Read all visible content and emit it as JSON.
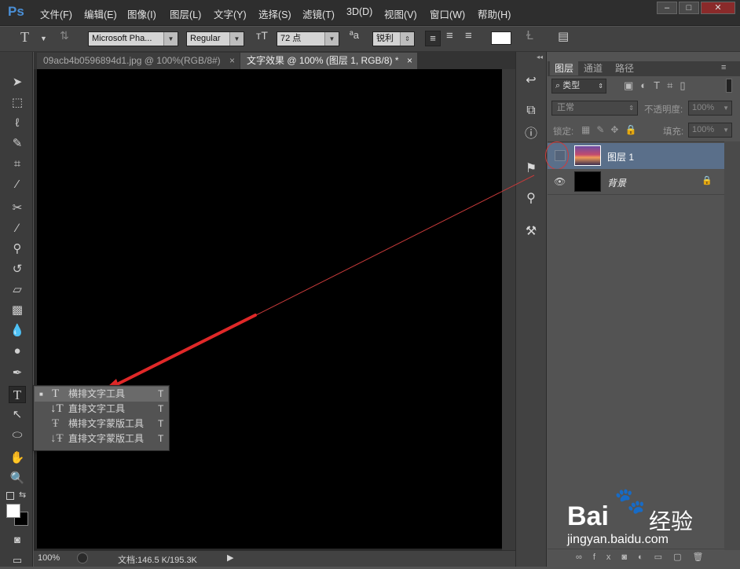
{
  "menubar": {
    "logo": "Ps",
    "items": [
      "文件(F)",
      "编辑(E)",
      "图像(I)",
      "图层(L)",
      "文字(Y)",
      "选择(S)",
      "滤镜(T)",
      "3D(D)",
      "视图(V)",
      "窗口(W)",
      "帮助(H)"
    ],
    "window_min": "–",
    "window_max": "□",
    "window_close": "✕"
  },
  "options": {
    "tool_glyph": "T",
    "font_family": "Microsoft Pha...",
    "font_style": "Regular",
    "size": "72 点",
    "antialias": "锐利",
    "color": "#ffffff"
  },
  "tabs": [
    {
      "label": "09acb4b0596894d1.jpg @ 100%(RGB/8#)",
      "close": "×"
    },
    {
      "label": "文字效果 @ 100% (图层 1, RGB/8) *",
      "close": "×"
    }
  ],
  "status": {
    "zoom": "100%",
    "doc": "文档:146.5 K/195.3K"
  },
  "flyout": [
    {
      "label": "横排文字工具",
      "key": "T",
      "icon": "horizontal-type-icon",
      "selected": true
    },
    {
      "label": "直排文字工具",
      "key": "T",
      "icon": "vertical-type-icon",
      "selected": false
    },
    {
      "label": "横排文字蒙版工具",
      "key": "T",
      "icon": "horizontal-type-mask-icon",
      "selected": false
    },
    {
      "label": "直排文字蒙版工具",
      "key": "T",
      "icon": "vertical-type-mask-icon",
      "selected": false
    }
  ],
  "layers_panel": {
    "tabs": [
      "图层",
      "通道",
      "路径"
    ],
    "filter": "类型",
    "blend": "正常",
    "opacity_label": "不透明度:",
    "opacity": "100%",
    "lock_label": "锁定:",
    "fill_label": "填充:",
    "fill": "100%",
    "layers": [
      {
        "name": "图层 1",
        "visible": false,
        "selected": true
      },
      {
        "name": "背景",
        "visible": true,
        "locked": true
      }
    ]
  },
  "watermark": {
    "brand": "Bai",
    "brand_suffix": "经验",
    "url": "jingyan.baidu.com"
  }
}
